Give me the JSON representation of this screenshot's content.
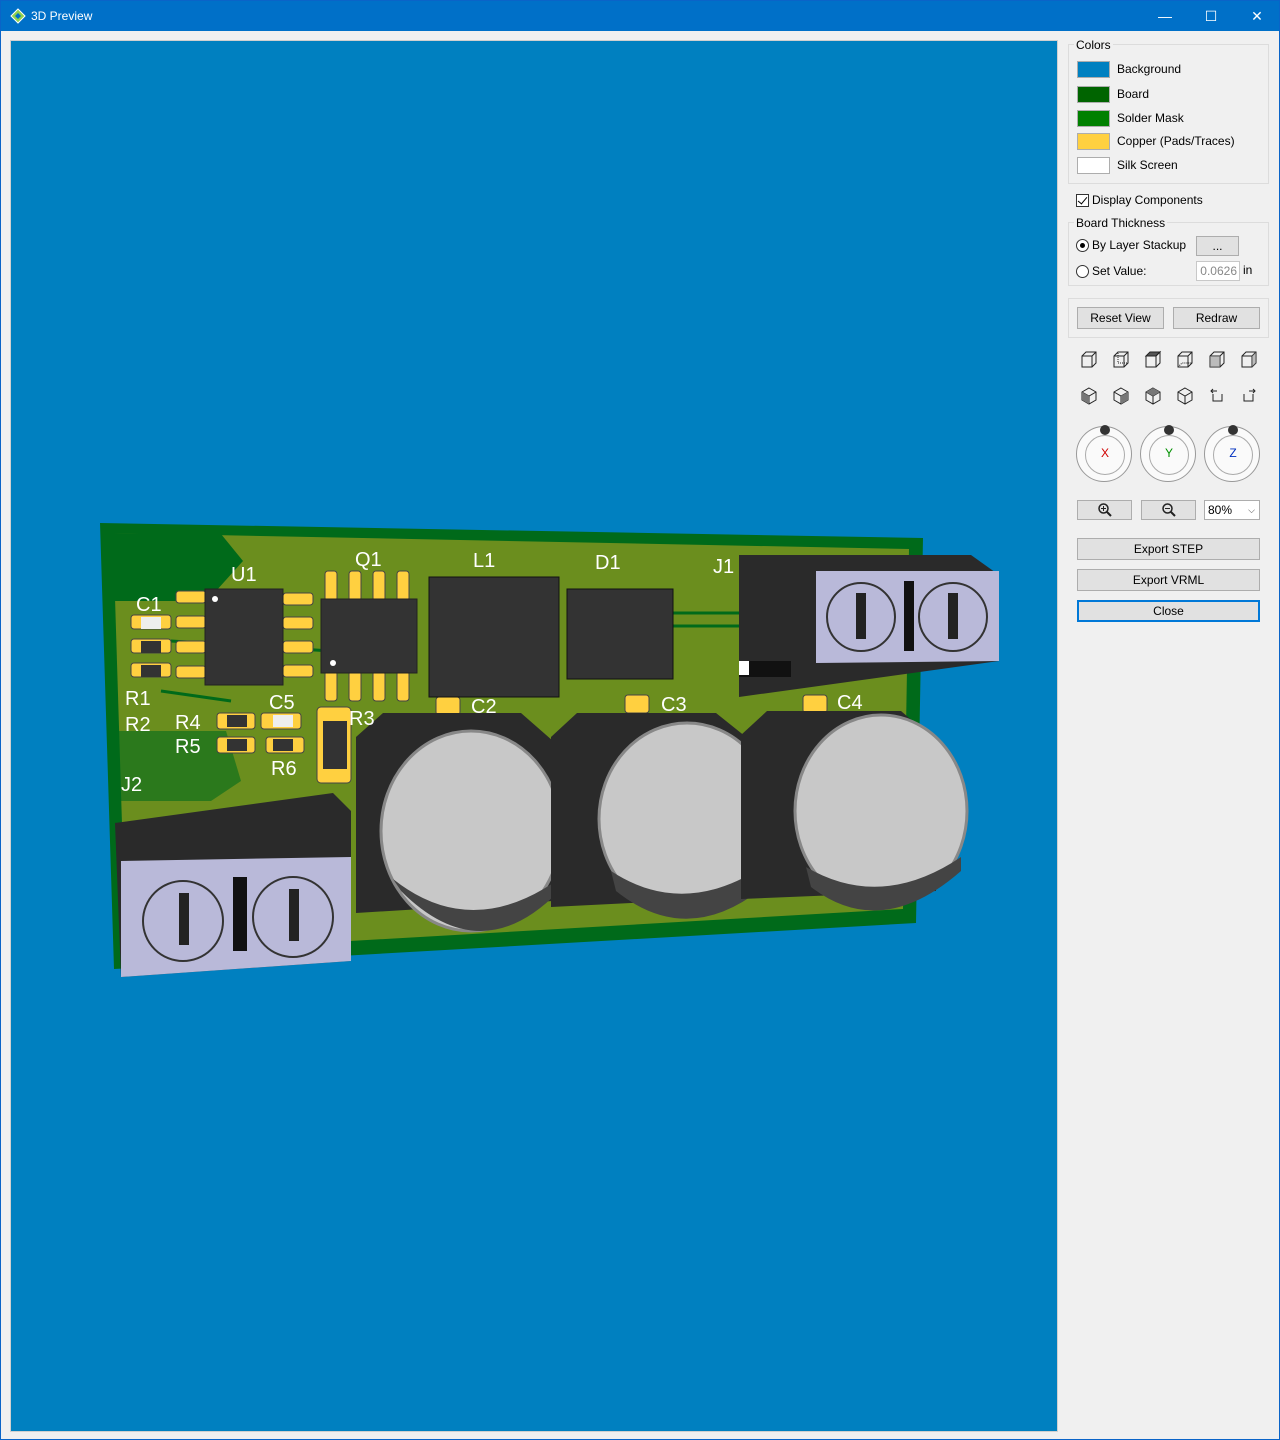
{
  "window": {
    "title": "3D Preview",
    "minimize_glyph": "—",
    "maximize_glyph": "☐",
    "close_glyph": "✕"
  },
  "viewport": {
    "background_color": "#0080c0",
    "silkscreen_labels": [
      "C1",
      "U1",
      "Q1",
      "L1",
      "D1",
      "J1",
      "R1",
      "R2",
      "R4",
      "C5",
      "R5",
      "R3",
      "R6",
      "C2",
      "C3",
      "C4",
      "J2"
    ]
  },
  "colors": {
    "title": "Colors",
    "items": [
      {
        "label": "Background",
        "color": "#0080c0"
      },
      {
        "label": "Board",
        "color": "#006400"
      },
      {
        "label": "Solder Mask",
        "color": "#008000"
      },
      {
        "label": "Copper (Pads/Traces)",
        "color": "#ffd040"
      },
      {
        "label": "Silk Screen",
        "color": "#ffffff"
      }
    ]
  },
  "display_components": {
    "label": "Display Components",
    "checked": true
  },
  "board_thickness": {
    "title": "Board Thickness",
    "by_layer_stackup_label": "By Layer Stackup",
    "stackup_button_label": "...",
    "set_value_label": "Set Value:",
    "value": "0.0626",
    "unit": "in",
    "selected": "by_layer_stackup"
  },
  "actions": {
    "reset_view": "Reset View",
    "redraw": "Redraw"
  },
  "view_icons": {
    "row1": [
      "front-view-icon",
      "back-view-icon",
      "top-view-icon",
      "bottom-view-icon",
      "left-view-icon",
      "right-view-icon"
    ],
    "row2": [
      "iso-front-left-icon",
      "iso-front-right-icon",
      "iso-back-left-icon",
      "iso-back-right-icon",
      "rotate-ccw-icon",
      "rotate-cw-icon"
    ]
  },
  "dials": {
    "x_label": "X",
    "y_label": "Y",
    "z_label": "Z",
    "x_color": "#d00000",
    "y_color": "#009000",
    "z_color": "#0030c0"
  },
  "zoom": {
    "zoom_in_icon": "zoom-in-icon",
    "zoom_out_icon": "zoom-out-icon",
    "level": "80%"
  },
  "export": {
    "step": "Export STEP",
    "vrml": "Export VRML",
    "close": "Close"
  }
}
